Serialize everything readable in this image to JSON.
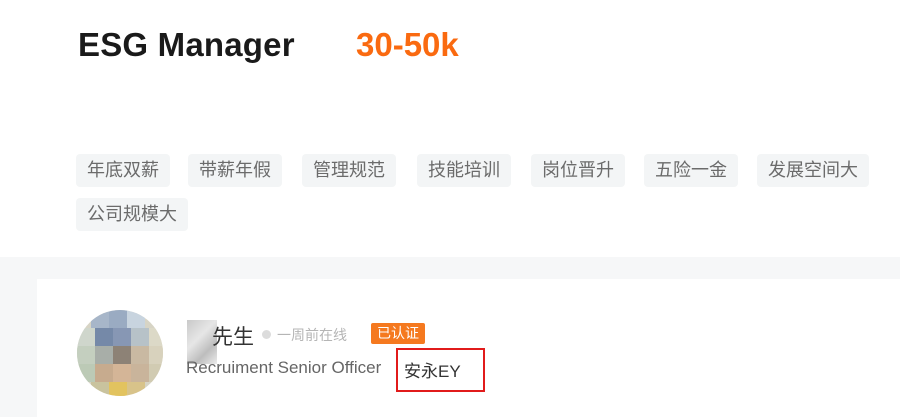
{
  "job": {
    "title": "ESG Manager",
    "salary": "30-50k",
    "tags": [
      "年底双薪",
      "带薪年假",
      "管理规范",
      "技能培训",
      "岗位晋升",
      "五险一金",
      "发展空间大",
      "公司规模大"
    ]
  },
  "recruiter": {
    "name_suffix": "先生",
    "online_status": "一周前在线",
    "verified_label": "已认证",
    "position": "Recruiment Senior Officer",
    "company": "安永EY"
  },
  "colors": {
    "salary": "#fa6a10",
    "verified_badge": "#f5791f",
    "highlight_box": "#e11b1b",
    "tag_background": "#f3f5f6"
  }
}
